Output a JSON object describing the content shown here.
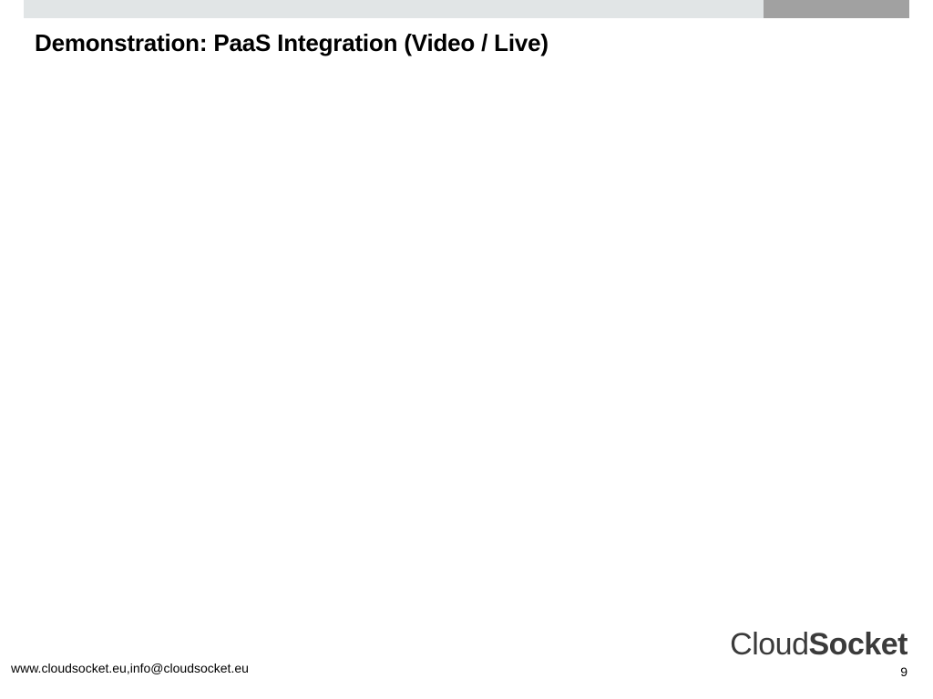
{
  "slide": {
    "title": "Demonstration: PaaS Integration (Video / Live)"
  },
  "footer": {
    "contact": "www.cloudsocket.eu,info@cloudsocket.eu",
    "page_number": "9"
  },
  "branding": {
    "logo_part1": "Cloud",
    "logo_part2": "Socket"
  }
}
